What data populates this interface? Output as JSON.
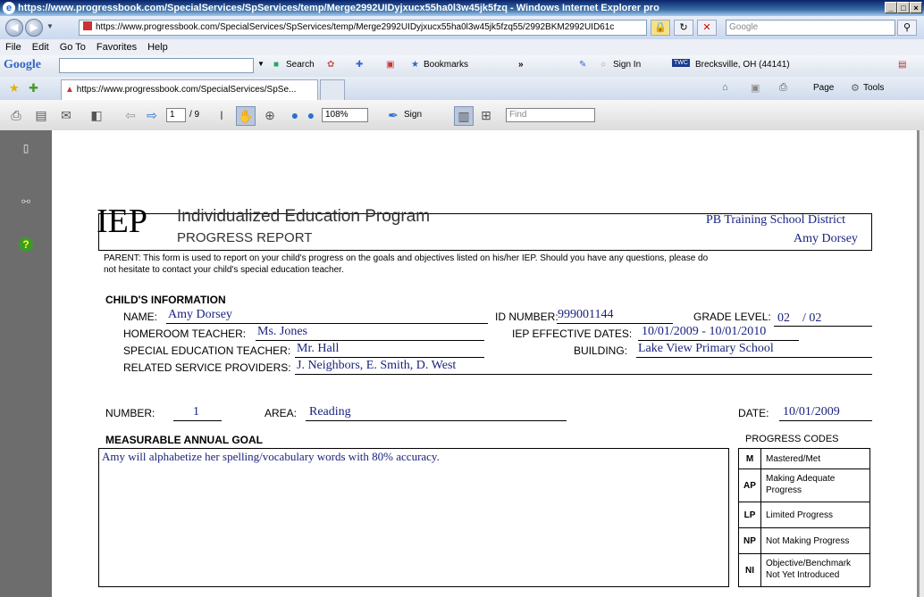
{
  "window": {
    "title": "https://www.progressbook.com/SpecialServices/SpServices/temp/Merge2992UIDyjxucx55ha0l3w45jk5fzq - Windows Internet Explorer pro",
    "address": "https://www.progressbook.com/SpecialServices/SpServices/temp/Merge2992UIDyjxucx55ha0l3w45jk5fzq55/2992BKM2992UID61c",
    "search_placeholder": "Google",
    "menu": [
      "File",
      "Edit",
      "Go To",
      "Favorites",
      "Help"
    ],
    "tab_label": "https://www.progressbook.com/SpecialServices/SpSe..."
  },
  "google_toolbar": {
    "logo": "Google",
    "search": "Search",
    "bookmarks": "Bookmarks",
    "more": "»",
    "sign_in": "Sign In",
    "twc": "TWC",
    "location": "Brecksville, OH (44141)"
  },
  "ie_cmd": {
    "page": "Page",
    "tools": "Tools"
  },
  "pdf_toolbar": {
    "page_current": "1",
    "page_total": "/ 9",
    "zoom": "108%",
    "sign": "Sign",
    "find_placeholder": "Find"
  },
  "doc": {
    "logo": "IEP",
    "title": "Individualized Education Program",
    "subtitle": "PROGRESS REPORT",
    "district": "PB Training School District",
    "student_header": "Amy Dorsey",
    "parent_note_1": "PARENT: This form is used to report on your child's progress on the goals and objectives listed on his/her IEP.  Should you have any questions, please do",
    "parent_note_2": "not hesitate to contact your child's special education teacher.",
    "child_info_heading": "CHILD'S INFORMATION",
    "name_label": "NAME:",
    "name": "Amy Dorsey",
    "id_label": "ID NUMBER:",
    "id": "999001144",
    "grade_label": "GRADE LEVEL:",
    "grade_a": "02",
    "grade_b": "/ 02",
    "homeroom_label": "HOMEROOM TEACHER:",
    "homeroom": "Ms. Jones",
    "iep_dates_label": "IEP EFFECTIVE DATES:",
    "iep_dates": "10/01/2009  -  10/01/2010",
    "sped_label": "SPECIAL EDUCATION TEACHER:",
    "sped": "Mr. Hall",
    "building_label": "BUILDING:",
    "building": "Lake View Primary School",
    "providers_label": "RELATED SERVICE PROVIDERS:",
    "providers": "J. Neighbors, E. Smith, D. West",
    "number_label": "NUMBER:",
    "number": "1",
    "area_label": "AREA:",
    "area": "Reading",
    "date_label": "DATE:",
    "date": "10/01/2009",
    "goal_heading": "MEASURABLE ANNUAL GOAL",
    "goal": "Amy will alphabetize her spelling/vocabulary words with 80% accuracy.",
    "codes_heading": "PROGRESS CODES",
    "codes": [
      {
        "code": "M",
        "desc1": "Mastered/Met",
        "desc2": ""
      },
      {
        "code": "AP",
        "desc1": "Making Adequate",
        "desc2": "Progress"
      },
      {
        "code": "LP",
        "desc1": "Limited Progress",
        "desc2": ""
      },
      {
        "code": "NP",
        "desc1": "Not Making Progress",
        "desc2": ""
      },
      {
        "code": "NI",
        "desc1": "Objective/Benchmark",
        "desc2": "Not Yet Introduced"
      }
    ]
  }
}
